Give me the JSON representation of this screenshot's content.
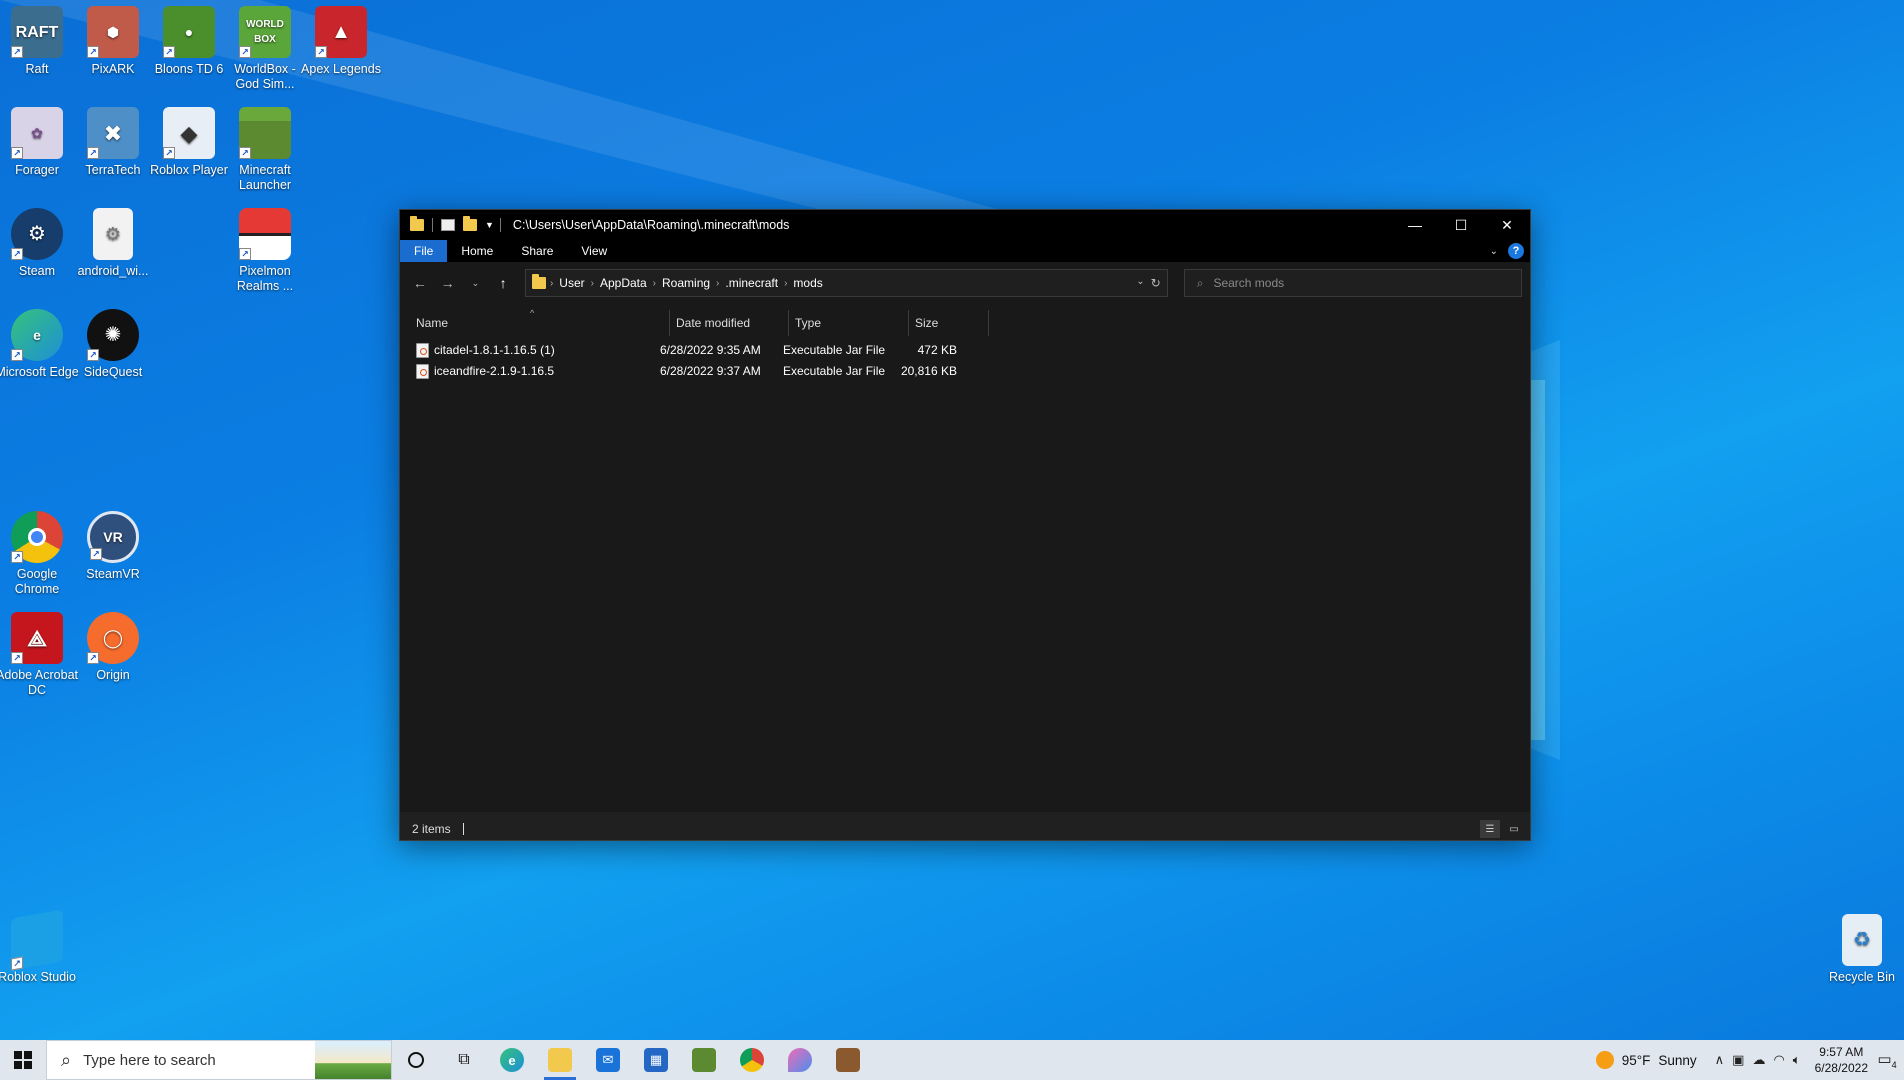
{
  "desktop": {
    "icons": [
      {
        "label": "Raft",
        "icon": "raft-icon",
        "color": "#3b6d8f"
      },
      {
        "label": "PixARK",
        "icon": "pixark-icon",
        "color": "#c05a49"
      },
      {
        "label": "Bloons TD 6",
        "icon": "bloons-icon",
        "color": "#4a8f2c"
      },
      {
        "label": "WorldBox - God Sim...",
        "icon": "worldbox-icon",
        "color": "#5aa63a"
      },
      {
        "label": "Apex Legends",
        "icon": "apex-icon",
        "color": "#c9252c"
      },
      {
        "label": "Forager",
        "icon": "forager-icon",
        "color": "#d8d3e6"
      },
      {
        "label": "TerraTech",
        "icon": "terratech-icon",
        "color": "#4f8fc8"
      },
      {
        "label": "Roblox Player",
        "icon": "roblox-player-icon",
        "color": "#e8eef5"
      },
      {
        "label": "Minecraft Launcher",
        "icon": "minecraft-launcher-icon",
        "color": "#5b8a31"
      },
      {
        "label": "Steam",
        "icon": "steam-icon",
        "color": "#163d6b"
      },
      {
        "label": "android_wi...",
        "icon": "settings-file-icon",
        "color": "#f2f2f2"
      },
      {
        "label": "Pixelmon Realms ...",
        "icon": "pokeball-icon",
        "color": "#e53935"
      },
      {
        "label": "Microsoft Edge",
        "icon": "edge-icon",
        "color": "#1d8fd8"
      },
      {
        "label": "SideQuest",
        "icon": "sidequest-icon",
        "color": "#111111"
      },
      {
        "label": "Google Chrome",
        "icon": "chrome-icon",
        "color": "#ffffff"
      },
      {
        "label": "SteamVR",
        "icon": "steamvr-icon",
        "color": "#2f4f7c"
      },
      {
        "label": "Adobe Acrobat DC",
        "icon": "acrobat-icon",
        "color": "#c4161c"
      },
      {
        "label": "Origin",
        "icon": "origin-icon",
        "color": "#f56c2d"
      },
      {
        "label": "Roblox Studio",
        "icon": "roblox-studio-icon",
        "color": "#1ba0e6"
      },
      {
        "label": "Recycle Bin",
        "icon": "recycle-bin-icon",
        "color": "#e6eef5"
      }
    ]
  },
  "explorer": {
    "title": "C:\\Users\\User\\AppData\\Roaming\\.minecraft\\mods",
    "ribbon_tabs": [
      "File",
      "Home",
      "Share",
      "View"
    ],
    "breadcrumb": [
      "User",
      "AppData",
      "Roaming",
      ".minecraft",
      "mods"
    ],
    "search_placeholder": "Search mods",
    "columns": [
      "Name",
      "Date modified",
      "Type",
      "Size"
    ],
    "files": [
      {
        "name": "citadel-1.8.1-1.16.5 (1)",
        "date": "6/28/2022 9:35 AM",
        "type": "Executable Jar File",
        "size": "472 KB"
      },
      {
        "name": "iceandfire-2.1.9-1.16.5",
        "date": "6/28/2022 9:37 AM",
        "type": "Executable Jar File",
        "size": "20,816 KB"
      }
    ],
    "status": "2 items",
    "accent": "#1a6ccf"
  },
  "taskbar": {
    "search_placeholder": "Type here to search",
    "weather_temp": "95°F",
    "weather_text": "Sunny",
    "time": "9:57 AM",
    "date": "6/28/2022",
    "notifications": "4"
  }
}
